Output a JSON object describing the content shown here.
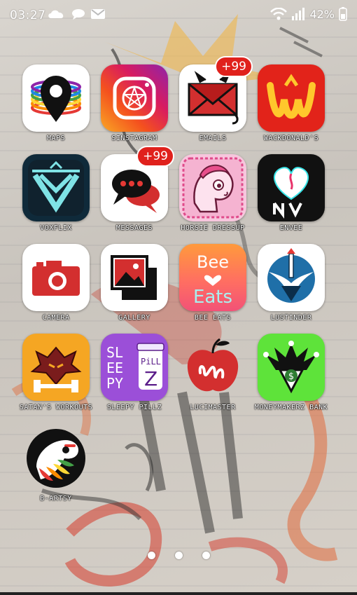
{
  "status_bar": {
    "time": "03:27",
    "battery": "42",
    "icons": [
      "cloud-icon",
      "chat-bubble-icon",
      "mail-icon",
      "wifi-icon",
      "signal-icon",
      "battery-icon"
    ]
  },
  "apps": [
    {
      "label": "MAPS",
      "icon": "maps-pin-icon"
    },
    {
      "label": "SINSTAGRAM",
      "icon": "sinstagram-pentagram-icon"
    },
    {
      "label": "EMAILS",
      "icon": "emails-envelope-icon",
      "badge": "+99"
    },
    {
      "label": "WACKDONALD'S",
      "icon": "wackdonalds-logo-icon"
    },
    {
      "label": "VOXFLIX",
      "icon": "voxflix-logo-icon"
    },
    {
      "label": "MESSAGES",
      "icon": "messages-bubble-icon",
      "badge": "+99"
    },
    {
      "label": "HORSIE DRESSUP",
      "icon": "horsie-dressup-icon"
    },
    {
      "label": "ENVEE",
      "icon": "envee-heart-icon"
    },
    {
      "label": "CAMERA",
      "icon": "camera-icon"
    },
    {
      "label": "GALLERY",
      "icon": "gallery-icon"
    },
    {
      "label": "BEE EATS",
      "icon": "bee-eats-icon",
      "icon_text": [
        "Bee",
        "Eats"
      ]
    },
    {
      "label": "LUSTINDER",
      "icon": "lustinder-icon"
    },
    {
      "label": "SATAN'S WORKOUTS",
      "icon": "satans-workouts-icon"
    },
    {
      "label": "SLEEPY PILLZ",
      "icon": "sleepy-pillz-icon",
      "icon_text": [
        "SL",
        "EE",
        "PY",
        "PiLL",
        "Z"
      ]
    },
    {
      "label": "LUCIMASTER",
      "icon": "lucimaster-apple-icon"
    },
    {
      "label": "MONEYMAKERZ BANK",
      "icon": "moneymakerz-bank-icon"
    },
    {
      "label": "B-ARTSY",
      "icon": "b-artsy-icon"
    }
  ],
  "pager": {
    "pages": 3,
    "current": 1
  },
  "colors": {
    "badge": "#e0211c",
    "label_text": "#ffffff"
  }
}
